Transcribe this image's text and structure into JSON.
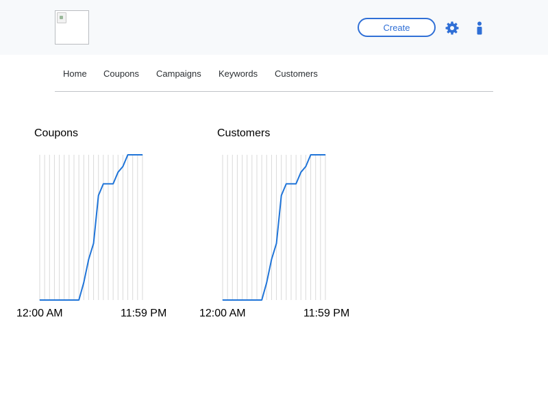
{
  "header": {
    "create_label": "Create",
    "accent_color": "#2f6fd6",
    "icons": [
      "broken-image-icon",
      "gear-icon",
      "info-icon"
    ]
  },
  "nav": {
    "items": [
      {
        "label": "Home"
      },
      {
        "label": "Coupons"
      },
      {
        "label": "Campaigns"
      },
      {
        "label": "Keywords"
      },
      {
        "label": "Customers"
      }
    ]
  },
  "charts": [
    {
      "start_label": "12:00 AM",
      "end_label": "11:59 PM"
    },
    {
      "start_label": "12:00 AM",
      "end_label": "11:59 PM"
    }
  ],
  "chart_data": [
    {
      "type": "line",
      "title": "Coupons",
      "xlabel": "",
      "ylabel": "",
      "x_tick_labels": [
        "12:00 AM",
        "11:59 PM"
      ],
      "grid": "vertical",
      "line_color": "#1f74d8",
      "series": [
        {
          "values": [
            0,
            0,
            0,
            0,
            0,
            0,
            0,
            0,
            0,
            0.12,
            0.28,
            0.39,
            0.72,
            0.8,
            0.8,
            0.8,
            0.88,
            0.92,
            1,
            1,
            1,
            1
          ]
        }
      ],
      "ylim": [
        0,
        1
      ]
    },
    {
      "type": "line",
      "title": "Customers",
      "xlabel": "",
      "ylabel": "",
      "x_tick_labels": [
        "12:00 AM",
        "11:59 PM"
      ],
      "grid": "vertical",
      "line_color": "#1f74d8",
      "series": [
        {
          "values": [
            0,
            0,
            0,
            0,
            0,
            0,
            0,
            0,
            0,
            0.12,
            0.28,
            0.39,
            0.72,
            0.8,
            0.8,
            0.8,
            0.88,
            0.92,
            1,
            1,
            1,
            1
          ]
        }
      ],
      "ylim": [
        0,
        1
      ]
    }
  ]
}
